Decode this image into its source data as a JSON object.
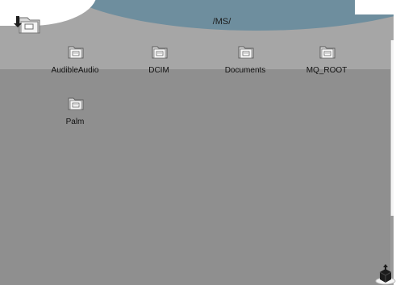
{
  "header": {
    "path": "/MS/",
    "up_icon": "folder-up-icon"
  },
  "files": [
    {
      "label": "AudibleAudio",
      "icon": "folder-icon"
    },
    {
      "label": "DCIM",
      "icon": "folder-icon"
    },
    {
      "label": "Documents",
      "icon": "folder-icon"
    },
    {
      "label": "MQ_ROOT",
      "icon": "folder-icon"
    },
    {
      "label": "Palm",
      "icon": "folder-icon"
    }
  ],
  "footer": {
    "action_icon": "home-cube-icon"
  },
  "colors": {
    "background": "#8f8f8f",
    "header_band": "#a6a6a6",
    "title_arc": "#6e8e9e",
    "label_text": "#111111"
  }
}
